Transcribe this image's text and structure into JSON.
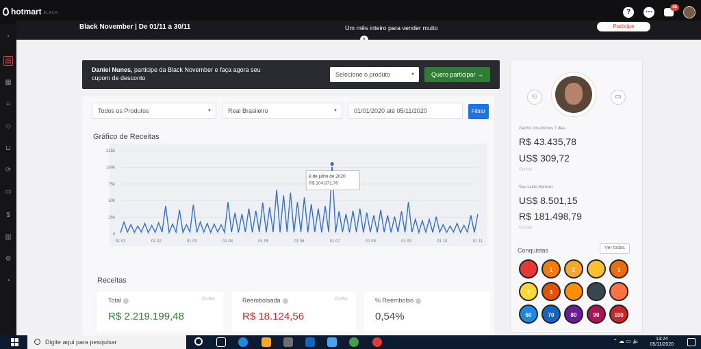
{
  "topbar": {
    "brand": "hotmart",
    "brand_tag": "BLACK",
    "notification_count": "68"
  },
  "banner": {
    "left_text": "Black November | De 01/11 a 30/11",
    "mid_text": "Um mês inteiro para vender muito",
    "button": "Participe"
  },
  "promo": {
    "name": "Daniel Nunes,",
    "text": " participe da Black November e faça agora seu cupom de desconto",
    "select_placeholder": "Selecione o produto",
    "button": "Quero participar →"
  },
  "filters": {
    "products": "Todos os Produtos",
    "currency": "Real Brasileiro",
    "date_range": "01/01/2020 até 05/11/2020",
    "submit": "Filtrar"
  },
  "chart": {
    "title": "Gráfico de Receitas",
    "tooltip_date": "8 de julho de 2020",
    "tooltip_value": "R$ 104.871,76"
  },
  "chart_data": {
    "type": "line",
    "title": "Gráfico de Receitas",
    "xlabel": "",
    "ylabel": "",
    "ylim": [
      0,
      125000
    ],
    "y_ticks": [
      "0",
      "25k",
      "50k",
      "75k",
      "100k",
      "125k"
    ],
    "x_ticks": [
      "01 01",
      "01 02",
      "01 03",
      "01 04",
      "01 05",
      "01 06",
      "01 07",
      "01 08",
      "01 09",
      "01 10",
      "01 11"
    ],
    "grid": true,
    "series": [
      {
        "color": "#2f6fd6",
        "values": [
          2000,
          18000,
          3000,
          14000,
          2500,
          12000,
          3000,
          16000,
          2000,
          13000,
          2500,
          17000,
          3000,
          42000,
          2500,
          15000,
          3000,
          36000,
          2500,
          14000,
          3000,
          44000,
          2500,
          18000,
          3000,
          16000,
          2500,
          15000,
          3000,
          14000,
          2500,
          48000,
          3000,
          32000,
          2500,
          30000,
          3000,
          38000,
          2500,
          35000,
          3000,
          47000,
          2500,
          40000,
          3000,
          66000,
          2500,
          58000,
          3000,
          62000,
          2500,
          48000,
          3000,
          55000,
          2500,
          45000,
          3000,
          38000,
          2500,
          42000,
          3000,
          104871,
          2500,
          34000,
          3000,
          30000,
          2500,
          35000,
          3000,
          38000,
          2500,
          32000,
          3000,
          28000,
          2500,
          36000,
          3000,
          28000,
          2500,
          26000,
          3000,
          34000,
          2500,
          48000,
          3000,
          22000,
          2500,
          20000,
          3000,
          22000,
          2500,
          26000,
          3000,
          14000,
          2500,
          12000,
          3000,
          16000,
          2500,
          13000,
          3000,
          28000,
          2500,
          30000
        ]
      }
    ],
    "annotation": {
      "x": "8 de julho de 2020",
      "y": 104871.76
    }
  },
  "receitas": {
    "title": "Receitas",
    "total_label": "Total",
    "total_value": "R$ 2.219.199,48",
    "refund_label": "Reembolsada",
    "refund_value": "R$ 18.124,56",
    "refund_pct_label": "% Reembolso",
    "refund_pct_value": "0,54%",
    "hide": "Ocultar"
  },
  "panel": {
    "earned_label": "Ganho nos últimos 7 dias",
    "earned_brl": "R$ 43.435,78",
    "earned_usd": "US$ 309,72",
    "hide": "Ocultar",
    "balance_label": "Seu saldo Hotmart",
    "balance_usd": "US$ 8.501,15",
    "balance_brl": "R$ 181.498,79",
    "achievements": "Conquistas",
    "see_all": "Ver todas",
    "badges": [
      "",
      "1",
      "2",
      "",
      "1",
      "2",
      "3",
      "",
      "",
      "",
      "60",
      "70",
      "80",
      "90",
      "100"
    ]
  },
  "taskbar": {
    "search": "Digite aqui para pesquisar",
    "time": "13:24",
    "date": "05/11/2020"
  },
  "colors": {
    "accent": "#e0402f",
    "green": "#2e7d32",
    "blue": "#1a73e8",
    "line": "#2f6fd6"
  }
}
